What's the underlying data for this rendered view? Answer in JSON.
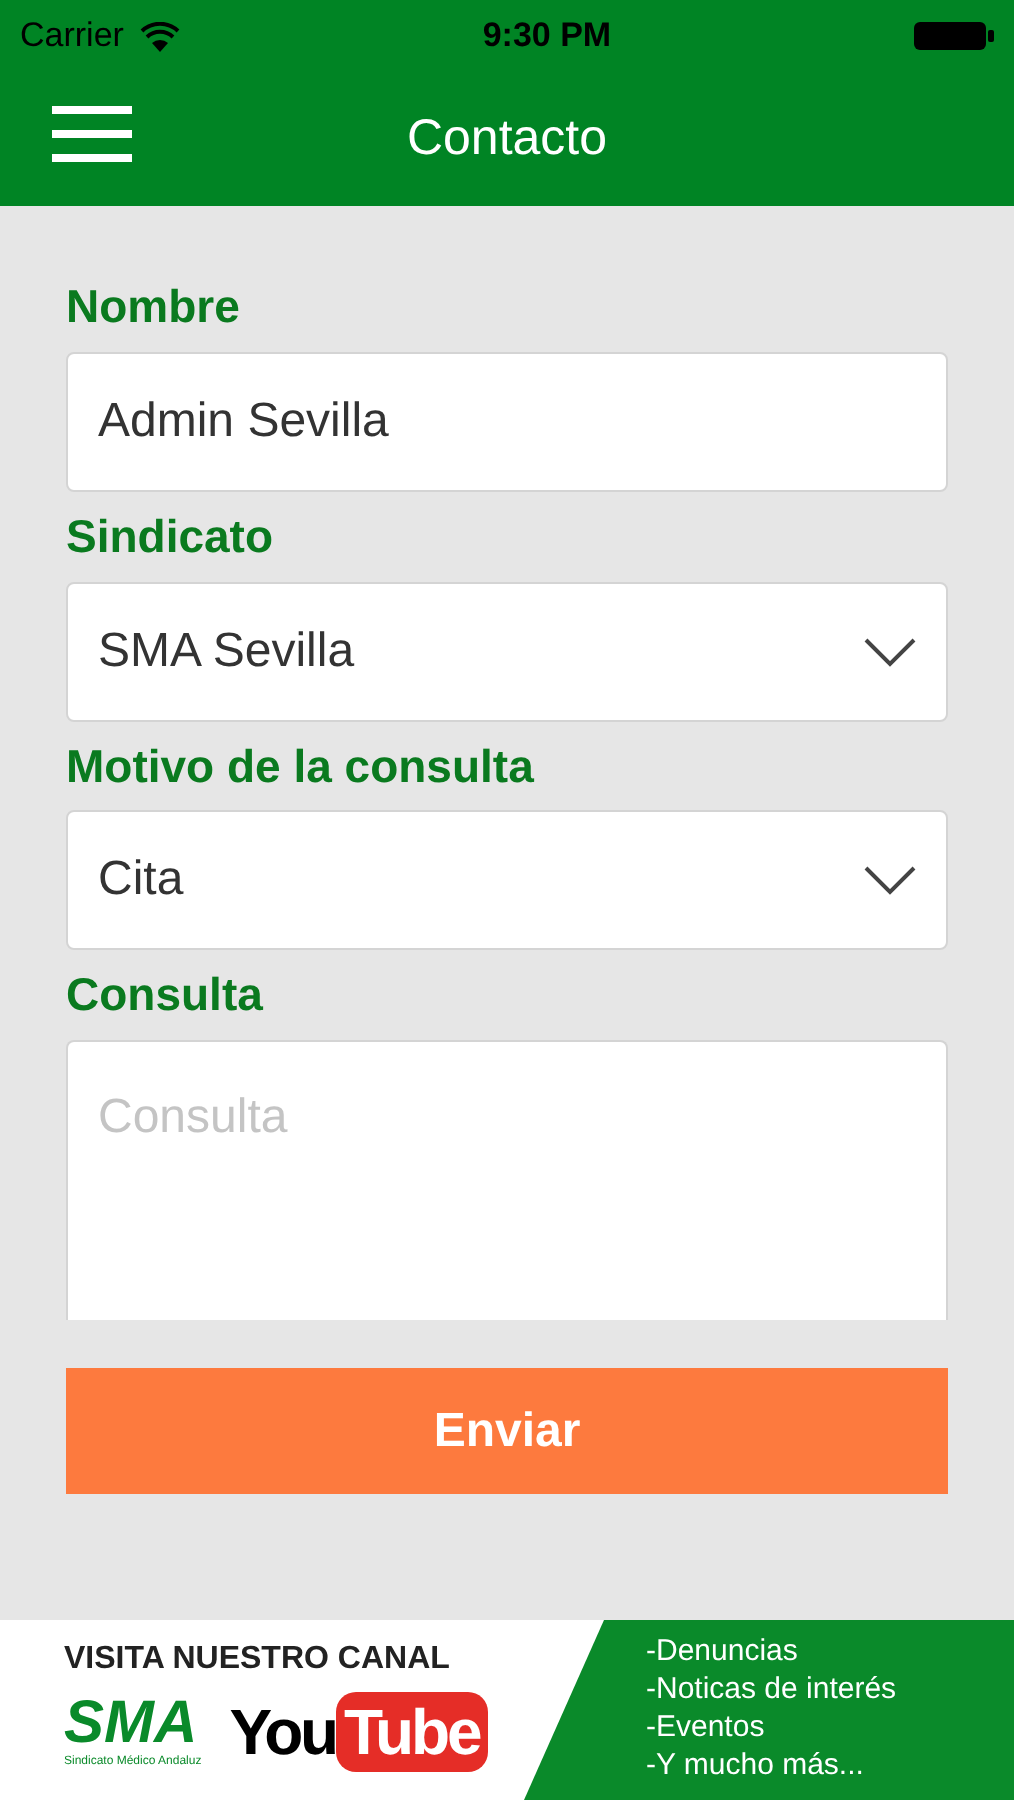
{
  "status_bar": {
    "carrier": "Carrier",
    "time": "9:30 PM"
  },
  "nav": {
    "title": "Contacto"
  },
  "fields": [
    {
      "kind": "text",
      "label": "Nombre",
      "value": "Admin Sevilla"
    },
    {
      "kind": "select",
      "label": "Sindicato",
      "value": "SMA Sevilla"
    },
    {
      "kind": "select",
      "label": "Motivo de la consulta",
      "value": "Cita"
    },
    {
      "kind": "textarea",
      "label": "Consulta",
      "placeholder": "Consulta"
    }
  ],
  "submit": {
    "label": "Enviar"
  },
  "banner": {
    "heading": "VISITA NUESTRO CANAL",
    "logo": "SMA",
    "logo_caption": "Sindicato Médico Andaluz",
    "video_brand": [
      "You",
      "Tube"
    ],
    "items": [
      "-Denuncias",
      "-Noticas de interés",
      "-Eventos",
      "-Y mucho más..."
    ]
  }
}
